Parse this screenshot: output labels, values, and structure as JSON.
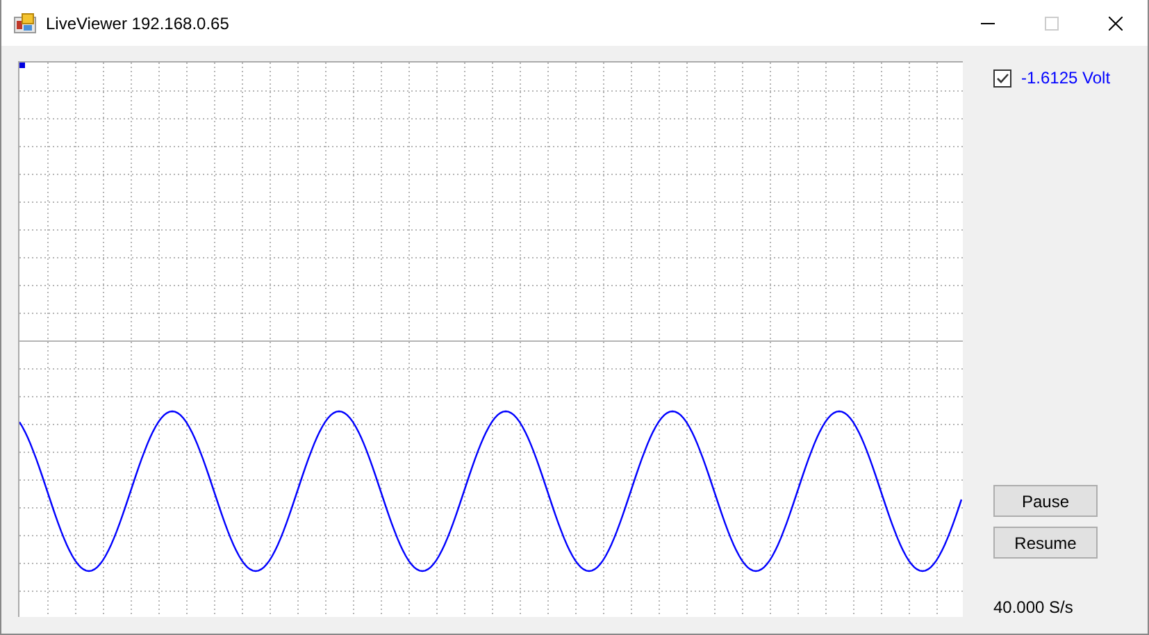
{
  "window": {
    "title": "LiveViewer 192.168.0.65"
  },
  "channel": {
    "checked": true,
    "reading": "-1.6125 Volt"
  },
  "buttons": [
    {
      "label": "Pause"
    },
    {
      "label": "Resume"
    }
  ],
  "sample_rate": "40.000 S/s"
}
